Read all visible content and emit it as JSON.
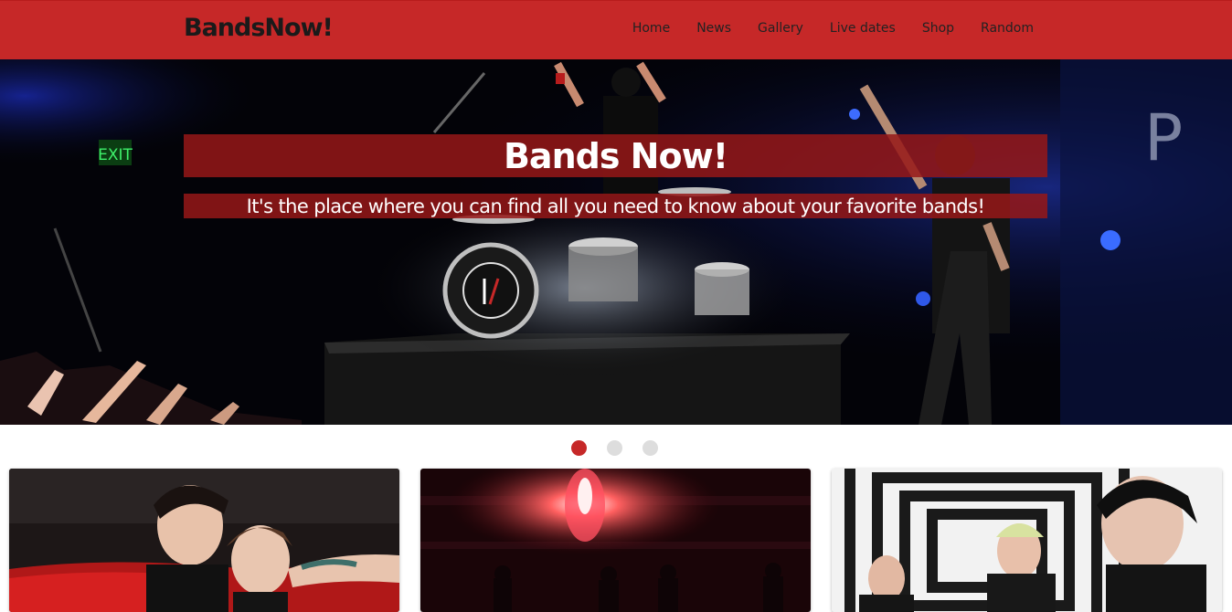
{
  "brand": {
    "name": "BandsNow!"
  },
  "nav": {
    "items": [
      {
        "label": "Home"
      },
      {
        "label": "News"
      },
      {
        "label": "Gallery"
      },
      {
        "label": "Live dates"
      },
      {
        "label": "Shop"
      },
      {
        "label": "Random"
      }
    ]
  },
  "hero": {
    "title": "Bands Now!",
    "subtitle": "It's the place where you can find all you need to know about your favorite bands!",
    "exit_sign": "EXIT"
  },
  "carousel": {
    "slide_count": 3,
    "active_index": 0
  },
  "cards": [
    {
      "name": "band-card-1"
    },
    {
      "name": "band-card-2"
    },
    {
      "name": "band-card-3"
    }
  ],
  "colors": {
    "brand": "#c62828",
    "overlay": "#961818",
    "dot_inactive": "#dddddd"
  }
}
